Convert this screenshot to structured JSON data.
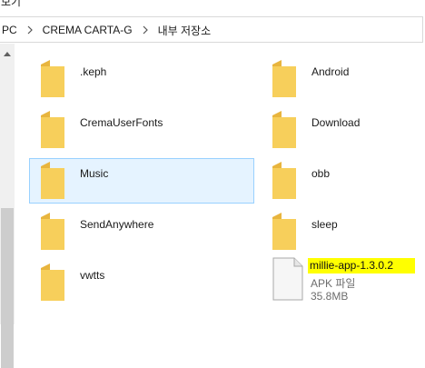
{
  "window": {
    "partial_top_label": "보기"
  },
  "breadcrumb": [
    {
      "label": "PC"
    },
    {
      "label": "CREMA CARTA-G"
    },
    {
      "label": "내부 저장소"
    }
  ],
  "items": [
    {
      "name": ".keph",
      "icon": "folder-icon"
    },
    {
      "name": "Android",
      "icon": "folder-icon"
    },
    {
      "name": "CremaUserFonts",
      "icon": "folder-icon"
    },
    {
      "name": "Download",
      "icon": "folder-icon"
    },
    {
      "name": "Music",
      "icon": "folder-icon",
      "selected": true
    },
    {
      "name": "obb",
      "icon": "folder-icon"
    },
    {
      "name": "SendAnywhere",
      "icon": "folder-icon"
    },
    {
      "name": "sleep",
      "icon": "folder-icon"
    },
    {
      "name": "vwtts",
      "icon": "folder-icon"
    },
    {
      "name": "millie-app-1.3.0.2",
      "icon": "file-icon",
      "type": "APK 파일",
      "size": "35.8MB",
      "highlight": "#ffff00"
    }
  ],
  "colors": {
    "folder": "#f7cf5b",
    "folder_back": "#e8b53e",
    "selection_fill": "#e5f3ff",
    "selection_border": "#99d1ff",
    "highlight": "#ffff00"
  }
}
